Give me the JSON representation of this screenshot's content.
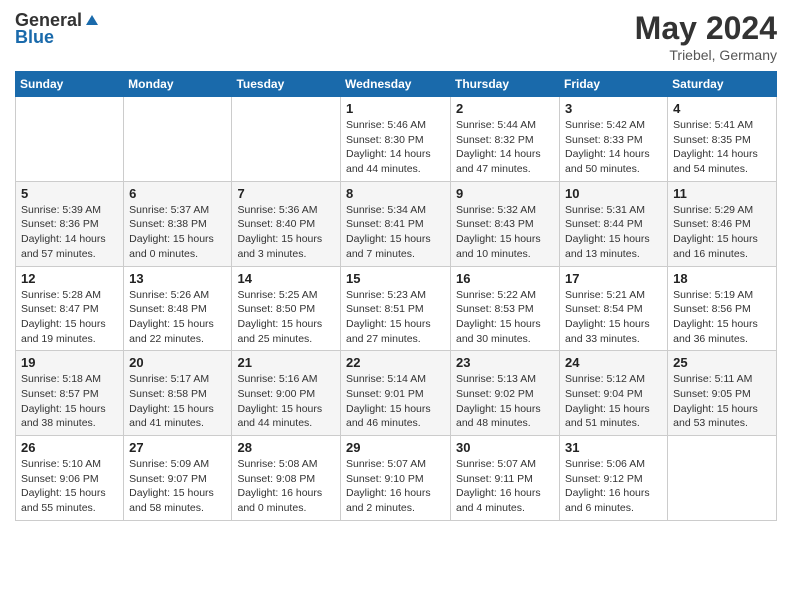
{
  "header": {
    "logo_general": "General",
    "logo_blue": "Blue",
    "title": "May 2024",
    "location": "Triebel, Germany"
  },
  "days_of_week": [
    "Sunday",
    "Monday",
    "Tuesday",
    "Wednesday",
    "Thursday",
    "Friday",
    "Saturday"
  ],
  "weeks": [
    [
      {
        "day": "",
        "info": ""
      },
      {
        "day": "",
        "info": ""
      },
      {
        "day": "",
        "info": ""
      },
      {
        "day": "1",
        "info": "Sunrise: 5:46 AM\nSunset: 8:30 PM\nDaylight: 14 hours\nand 44 minutes."
      },
      {
        "day": "2",
        "info": "Sunrise: 5:44 AM\nSunset: 8:32 PM\nDaylight: 14 hours\nand 47 minutes."
      },
      {
        "day": "3",
        "info": "Sunrise: 5:42 AM\nSunset: 8:33 PM\nDaylight: 14 hours\nand 50 minutes."
      },
      {
        "day": "4",
        "info": "Sunrise: 5:41 AM\nSunset: 8:35 PM\nDaylight: 14 hours\nand 54 minutes."
      }
    ],
    [
      {
        "day": "5",
        "info": "Sunrise: 5:39 AM\nSunset: 8:36 PM\nDaylight: 14 hours\nand 57 minutes."
      },
      {
        "day": "6",
        "info": "Sunrise: 5:37 AM\nSunset: 8:38 PM\nDaylight: 15 hours\nand 0 minutes."
      },
      {
        "day": "7",
        "info": "Sunrise: 5:36 AM\nSunset: 8:40 PM\nDaylight: 15 hours\nand 3 minutes."
      },
      {
        "day": "8",
        "info": "Sunrise: 5:34 AM\nSunset: 8:41 PM\nDaylight: 15 hours\nand 7 minutes."
      },
      {
        "day": "9",
        "info": "Sunrise: 5:32 AM\nSunset: 8:43 PM\nDaylight: 15 hours\nand 10 minutes."
      },
      {
        "day": "10",
        "info": "Sunrise: 5:31 AM\nSunset: 8:44 PM\nDaylight: 15 hours\nand 13 minutes."
      },
      {
        "day": "11",
        "info": "Sunrise: 5:29 AM\nSunset: 8:46 PM\nDaylight: 15 hours\nand 16 minutes."
      }
    ],
    [
      {
        "day": "12",
        "info": "Sunrise: 5:28 AM\nSunset: 8:47 PM\nDaylight: 15 hours\nand 19 minutes."
      },
      {
        "day": "13",
        "info": "Sunrise: 5:26 AM\nSunset: 8:48 PM\nDaylight: 15 hours\nand 22 minutes."
      },
      {
        "day": "14",
        "info": "Sunrise: 5:25 AM\nSunset: 8:50 PM\nDaylight: 15 hours\nand 25 minutes."
      },
      {
        "day": "15",
        "info": "Sunrise: 5:23 AM\nSunset: 8:51 PM\nDaylight: 15 hours\nand 27 minutes."
      },
      {
        "day": "16",
        "info": "Sunrise: 5:22 AM\nSunset: 8:53 PM\nDaylight: 15 hours\nand 30 minutes."
      },
      {
        "day": "17",
        "info": "Sunrise: 5:21 AM\nSunset: 8:54 PM\nDaylight: 15 hours\nand 33 minutes."
      },
      {
        "day": "18",
        "info": "Sunrise: 5:19 AM\nSunset: 8:56 PM\nDaylight: 15 hours\nand 36 minutes."
      }
    ],
    [
      {
        "day": "19",
        "info": "Sunrise: 5:18 AM\nSunset: 8:57 PM\nDaylight: 15 hours\nand 38 minutes."
      },
      {
        "day": "20",
        "info": "Sunrise: 5:17 AM\nSunset: 8:58 PM\nDaylight: 15 hours\nand 41 minutes."
      },
      {
        "day": "21",
        "info": "Sunrise: 5:16 AM\nSunset: 9:00 PM\nDaylight: 15 hours\nand 44 minutes."
      },
      {
        "day": "22",
        "info": "Sunrise: 5:14 AM\nSunset: 9:01 PM\nDaylight: 15 hours\nand 46 minutes."
      },
      {
        "day": "23",
        "info": "Sunrise: 5:13 AM\nSunset: 9:02 PM\nDaylight: 15 hours\nand 48 minutes."
      },
      {
        "day": "24",
        "info": "Sunrise: 5:12 AM\nSunset: 9:04 PM\nDaylight: 15 hours\nand 51 minutes."
      },
      {
        "day": "25",
        "info": "Sunrise: 5:11 AM\nSunset: 9:05 PM\nDaylight: 15 hours\nand 53 minutes."
      }
    ],
    [
      {
        "day": "26",
        "info": "Sunrise: 5:10 AM\nSunset: 9:06 PM\nDaylight: 15 hours\nand 55 minutes."
      },
      {
        "day": "27",
        "info": "Sunrise: 5:09 AM\nSunset: 9:07 PM\nDaylight: 15 hours\nand 58 minutes."
      },
      {
        "day": "28",
        "info": "Sunrise: 5:08 AM\nSunset: 9:08 PM\nDaylight: 16 hours\nand 0 minutes."
      },
      {
        "day": "29",
        "info": "Sunrise: 5:07 AM\nSunset: 9:10 PM\nDaylight: 16 hours\nand 2 minutes."
      },
      {
        "day": "30",
        "info": "Sunrise: 5:07 AM\nSunset: 9:11 PM\nDaylight: 16 hours\nand 4 minutes."
      },
      {
        "day": "31",
        "info": "Sunrise: 5:06 AM\nSunset: 9:12 PM\nDaylight: 16 hours\nand 6 minutes."
      },
      {
        "day": "",
        "info": ""
      }
    ]
  ]
}
